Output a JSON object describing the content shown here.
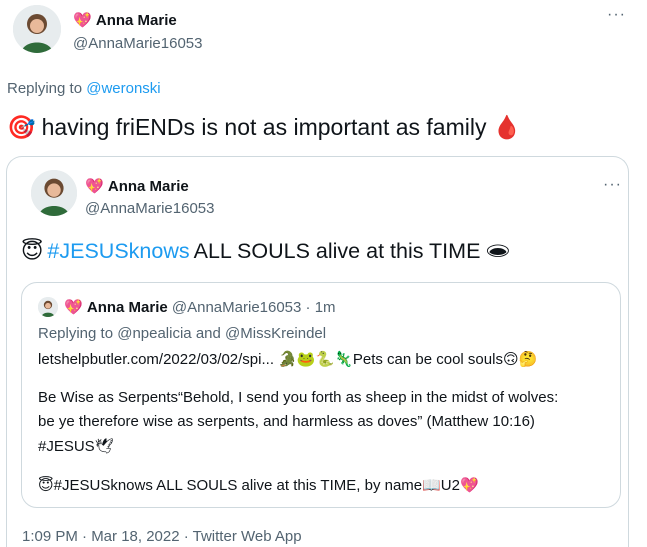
{
  "tweet": {
    "author": {
      "heart": "💖",
      "name": "Anna Marie",
      "handle": "@AnnaMarie16053"
    },
    "more": "···",
    "replying_prefix": "Replying to ",
    "replying_to": "@weronski",
    "text_emoji_start": "🎯",
    "text": "having friENDs is not as important as family",
    "text_emoji_end": "🩸"
  },
  "quoted": {
    "author": {
      "heart": "💖",
      "name": "Anna Marie",
      "handle": "@AnnaMarie16053"
    },
    "more": "···",
    "emoji_start": "😇",
    "hashtag": "#JESUSknows",
    "text": "ALL SOULS alive at this TIME",
    "emoji_end": "🕳",
    "timestamp": "1:09 PM · Mar 18, 2022 · Twitter Web App"
  },
  "inner": {
    "author": {
      "heart": "💖",
      "name": "Anna Marie",
      "handle": "@AnnaMarie16053",
      "age": "· 1m"
    },
    "replying": "Replying to @npealicia and @MissKreindel",
    "link_line": "letshelpbutler.com/2022/03/02/spi... 🐊🐸🐍🦎Pets can be cool souls🙃🤔",
    "body1": "Be Wise as Serpents“Behold, I send you forth as sheep in the midst of wolves:",
    "body2": "be ye therefore wise as serpents, and harmless as doves” (Matthew 10:16)",
    "body3": "#JESUS🕊",
    "footer": "😇#JESUSknows ALL SOULS alive at this TIME, by name📖U2💖"
  },
  "colors": {
    "link": "#1d9bf0",
    "secondary": "#536471",
    "border": "#cfd9de",
    "text": "#0f1419"
  }
}
